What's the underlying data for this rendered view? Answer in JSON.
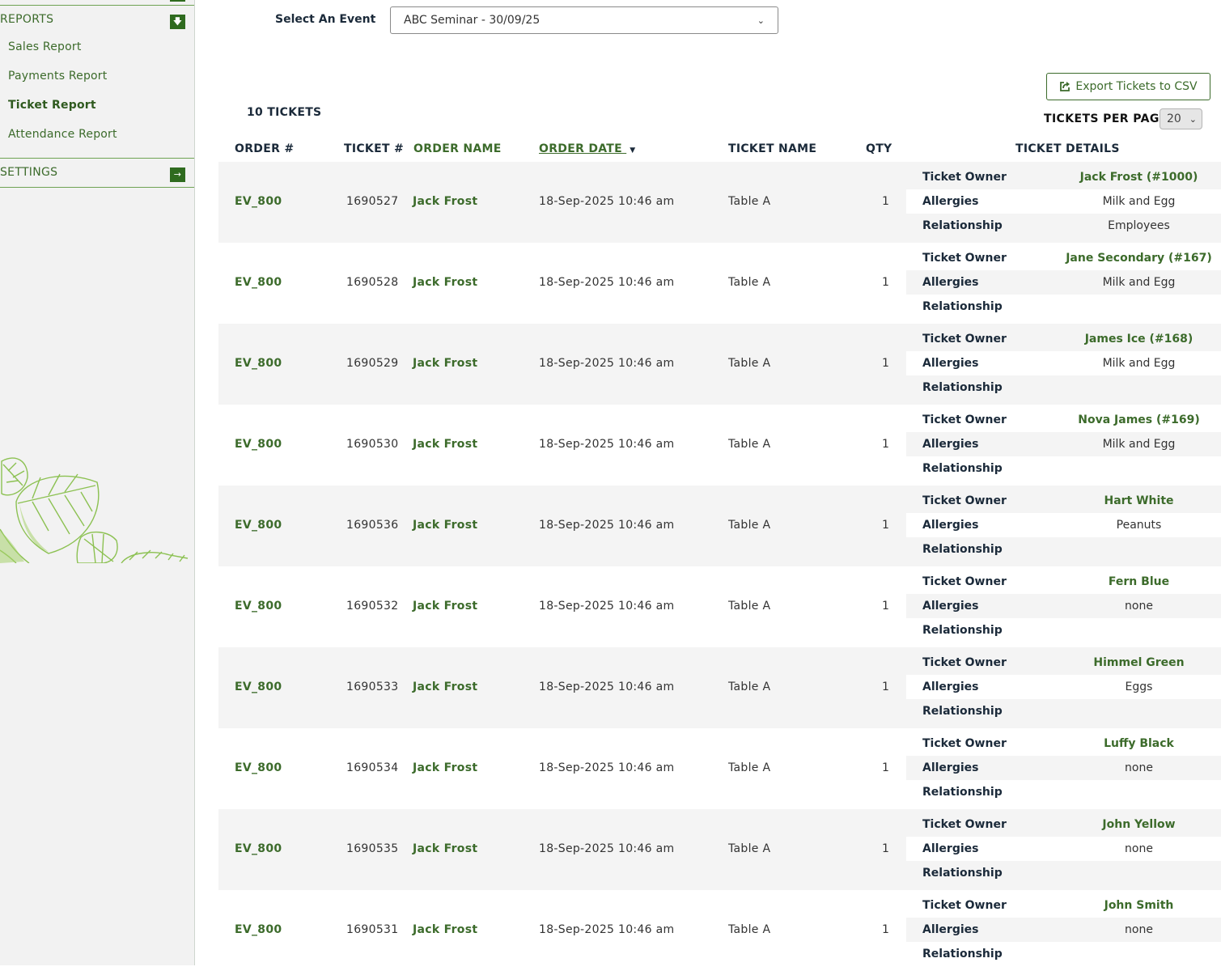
{
  "sidebar": {
    "reports_label": "REPORTS",
    "settings_label": "SETTINGS",
    "items": [
      {
        "label": "Sales Report",
        "active": false
      },
      {
        "label": "Payments Report",
        "active": false
      },
      {
        "label": "Ticket Report",
        "active": true
      },
      {
        "label": "Attendance Report",
        "active": false
      }
    ]
  },
  "event": {
    "label": "Select An Event",
    "selected": "ABC Seminar - 30/09/25"
  },
  "export_label": "Export Tickets to CSV",
  "tickets_count": "10 TICKETS",
  "per_page": {
    "label": "TICKETS PER PAGE",
    "value": "20"
  },
  "columns": {
    "order": "ORDER #",
    "ticket": "TICKET #",
    "order_name": "ORDER NAME",
    "order_date": "ORDER DATE",
    "ticket_name": "TICKET NAME",
    "qty": "QTY",
    "details": "TICKET DETAILS"
  },
  "detail_keys": {
    "owner": "Ticket Owner",
    "allergies": "Allergies",
    "relationship": "Relationship"
  },
  "rows": [
    {
      "order": "EV_800",
      "ticket": "1690527",
      "name": "Jack Frost",
      "date": "18-Sep-2025 10:46 am",
      "tname": "Table A",
      "qty": "1",
      "owner": "Jack Frost (#1000)",
      "allergies": "Milk and Egg",
      "relationship": "Employees"
    },
    {
      "order": "EV_800",
      "ticket": "1690528",
      "name": "Jack Frost",
      "date": "18-Sep-2025 10:46 am",
      "tname": "Table A",
      "qty": "1",
      "owner": "Jane Secondary (#167)",
      "allergies": "Milk and Egg",
      "relationship": ""
    },
    {
      "order": "EV_800",
      "ticket": "1690529",
      "name": "Jack Frost",
      "date": "18-Sep-2025 10:46 am",
      "tname": "Table A",
      "qty": "1",
      "owner": "James Ice (#168)",
      "allergies": "Milk and Egg",
      "relationship": ""
    },
    {
      "order": "EV_800",
      "ticket": "1690530",
      "name": "Jack Frost",
      "date": "18-Sep-2025 10:46 am",
      "tname": "Table A",
      "qty": "1",
      "owner": "Nova James (#169)",
      "allergies": "Milk and Egg",
      "relationship": ""
    },
    {
      "order": "EV_800",
      "ticket": "1690536",
      "name": "Jack Frost",
      "date": "18-Sep-2025 10:46 am",
      "tname": "Table A",
      "qty": "1",
      "owner": "Hart White",
      "allergies": "Peanuts",
      "relationship": ""
    },
    {
      "order": "EV_800",
      "ticket": "1690532",
      "name": "Jack Frost",
      "date": "18-Sep-2025 10:46 am",
      "tname": "Table A",
      "qty": "1",
      "owner": "Fern Blue",
      "allergies": "none",
      "relationship": ""
    },
    {
      "order": "EV_800",
      "ticket": "1690533",
      "name": "Jack Frost",
      "date": "18-Sep-2025 10:46 am",
      "tname": "Table A",
      "qty": "1",
      "owner": "Himmel Green",
      "allergies": "Eggs",
      "relationship": ""
    },
    {
      "order": "EV_800",
      "ticket": "1690534",
      "name": "Jack Frost",
      "date": "18-Sep-2025 10:46 am",
      "tname": "Table A",
      "qty": "1",
      "owner": "Luffy Black",
      "allergies": "none",
      "relationship": ""
    },
    {
      "order": "EV_800",
      "ticket": "1690535",
      "name": "Jack Frost",
      "date": "18-Sep-2025 10:46 am",
      "tname": "Table A",
      "qty": "1",
      "owner": "John Yellow",
      "allergies": "none",
      "relationship": ""
    },
    {
      "order": "EV_800",
      "ticket": "1690531",
      "name": "Jack Frost",
      "date": "18-Sep-2025 10:46 am",
      "tname": "Table A",
      "qty": "1",
      "owner": "John Smith",
      "allergies": "none",
      "relationship": ""
    }
  ],
  "icons": {
    "reports_toggle": "arrow-down-icon",
    "settings_toggle": "arrow-right-icon",
    "export": "external-share-icon",
    "sort": "sort-desc-icon",
    "decoration": "leaf-decoration-icon"
  },
  "colors": {
    "accent": "#3c6b2b",
    "button_bg": "#2f6b1f",
    "text": "#1b2a3a",
    "row_alt": "#f4f4f4"
  }
}
